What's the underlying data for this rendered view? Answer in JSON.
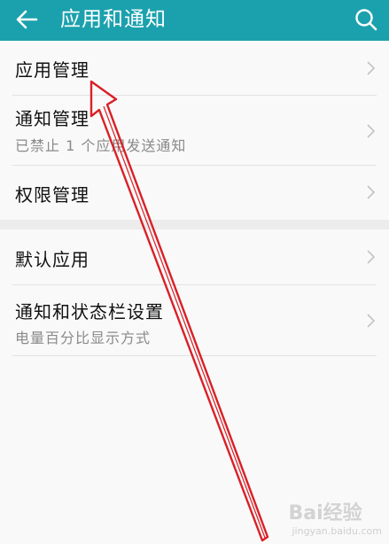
{
  "header": {
    "title": "应用和通知",
    "back_icon": "back-arrow-icon",
    "search_icon": "search-icon",
    "background": "#1ba1ad"
  },
  "groups": [
    {
      "items": [
        {
          "title": "应用管理",
          "subtitle": ""
        },
        {
          "title": "通知管理",
          "subtitle": "已禁止 1 个应用发送通知"
        },
        {
          "title": "权限管理",
          "subtitle": ""
        }
      ]
    },
    {
      "items": [
        {
          "title": "默认应用",
          "subtitle": ""
        },
        {
          "title": "通知和状态栏设置",
          "subtitle": "电量百分比显示方式"
        }
      ]
    }
  ],
  "annotation": {
    "color": "#d92027",
    "icon": "red-arrow-annotation"
  },
  "watermark": {
    "logo": "Bai经验",
    "sub": "jingyan.baidu.com"
  }
}
